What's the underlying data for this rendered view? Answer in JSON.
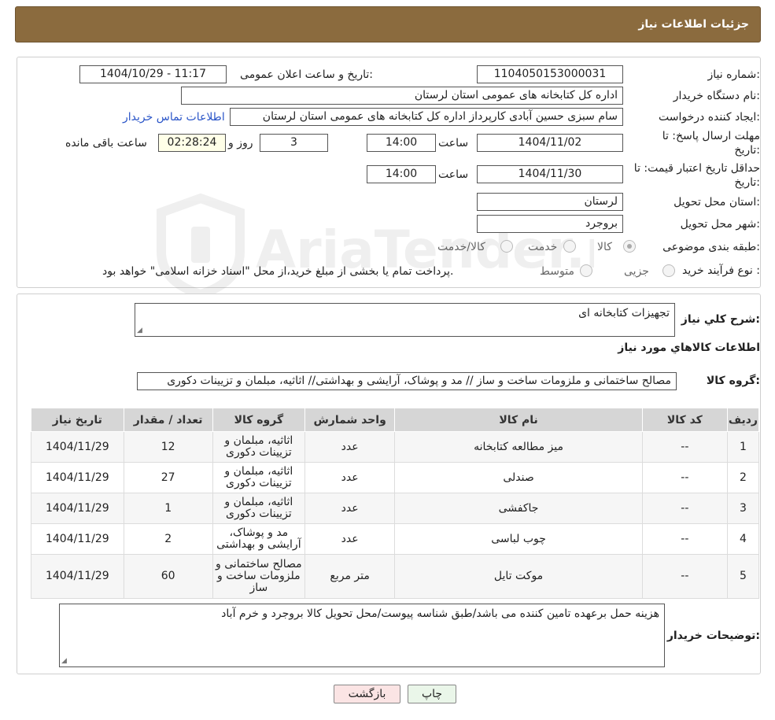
{
  "header": {
    "title": "جزئیات اطلاعات نیاز"
  },
  "form": {
    "need_number_label": "شماره نیاز:",
    "need_number": "1104050153000031",
    "announce_label": "تاریخ و ساعت اعلان عمومی:",
    "announce_value": "1404/10/29 - 11:17",
    "buyer_label": "نام دستگاه خریدار:",
    "buyer_value": "اداره کل کتابخانه های عمومی استان لرستان",
    "creator_label": "ایجاد کننده درخواست:",
    "creator_value": "سام سبزی حسین آبادی کارپرداز اداره کل کتابخانه های عمومی استان لرستان",
    "contact_link": "اطلاعات تماس خریدار",
    "deadline_label_1": "مهلت ارسال پاسخ: تا",
    "deadline_label_2": "تاریخ:",
    "deadline_date": "1404/11/02",
    "time_label": "ساعت",
    "deadline_time": "14:00",
    "days_value": "3",
    "days_label": "روز و",
    "remaining_time": "02:28:24",
    "remaining_label": "ساعت باقی مانده",
    "validity_label_1": "حداقل تاریخ اعتبار قیمت: تا",
    "validity_label_2": "تاریخ:",
    "validity_date": "1404/11/30",
    "validity_time": "14:00",
    "province_label": "استان محل تحویل:",
    "province_value": "لرستان",
    "city_label": "شهر محل تحویل:",
    "city_value": "بروجرد",
    "category_label": "طبقه بندی موضوعی:",
    "category_options": [
      "کالا",
      "خدمت",
      "کالا/خدمت"
    ],
    "process_label": "نوع فرآیند خرید :",
    "process_options": [
      "جزیی",
      "متوسط"
    ],
    "process_note": "پرداخت تمام یا بخشی از مبلغ خرید،از محل \"اسناد خزانه اسلامی\" خواهد بود."
  },
  "details": {
    "summary_label": "شرح کلي نیاز:",
    "summary_value": "تجهیزات کتابخانه ای",
    "goods_info_title": "اطلاعات کالاهاي مورد نیاز",
    "goods_group_label": "گروه کالا:",
    "goods_group_value": "مصالح ساختمانی و ملزومات ساخت و ساز // مد و پوشاک، آرایشی و بهداشتی// اثاثیه، مبلمان و تزیینات دکوری"
  },
  "table": {
    "headers": [
      "ردیف",
      "کد کالا",
      "نام کالا",
      "واحد شمارش",
      "گروه کالا",
      "تعداد / مقدار",
      "تاریخ نیاز"
    ],
    "rows": [
      [
        "1",
        "--",
        "میز مطالعه کتابخانه",
        "عدد",
        "اثاثیه، مبلمان و تزیینات دکوری",
        "12",
        "1404/11/29"
      ],
      [
        "2",
        "--",
        "صندلی",
        "عدد",
        "اثاثیه، مبلمان و تزیینات دکوری",
        "27",
        "1404/11/29"
      ],
      [
        "3",
        "--",
        "جاکفشی",
        "عدد",
        "اثاثیه، مبلمان و تزیینات دکوری",
        "1",
        "1404/11/29"
      ],
      [
        "4",
        "--",
        "چوب لباسی",
        "عدد",
        "مد و پوشاک، آرایشی و بهداشتی",
        "2",
        "1404/11/29"
      ],
      [
        "5",
        "--",
        "موکت تایل",
        "متر مربع",
        "مصالح ساختمانی و ملزومات ساخت و ساز",
        "60",
        "1404/11/29"
      ]
    ]
  },
  "buyer_notes": {
    "label": "توضیحات خریدار:",
    "value": "هزینه حمل برعهده تامین کننده می باشد/طبق شناسه پیوست/محل تحویل کالا بروجرد و خرم آباد"
  },
  "buttons": {
    "print": "چاپ",
    "back": "بازگشت"
  },
  "watermark": {
    "text": "AriaTender.neT"
  }
}
